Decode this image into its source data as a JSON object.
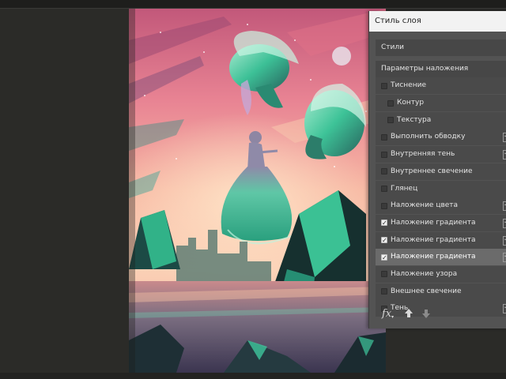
{
  "dialog": {
    "title": "Стиль слоя",
    "styles_label": "Стили",
    "blending_label": "Параметры наложения",
    "effects": [
      {
        "label": "Тиснение",
        "checked": false,
        "indent": false,
        "plus": false
      },
      {
        "label": "Контур",
        "checked": false,
        "indent": true,
        "plus": false
      },
      {
        "label": "Текстура",
        "checked": false,
        "indent": true,
        "plus": false
      },
      {
        "label": "Выполнить обводку",
        "checked": false,
        "indent": false,
        "plus": true
      },
      {
        "label": "Внутренняя тень",
        "checked": false,
        "indent": false,
        "plus": true
      },
      {
        "label": "Внутреннее свечение",
        "checked": false,
        "indent": false,
        "plus": false
      },
      {
        "label": "Глянец",
        "checked": false,
        "indent": false,
        "plus": false
      },
      {
        "label": "Наложение цвета",
        "checked": false,
        "indent": false,
        "plus": true
      },
      {
        "label": "Наложение градиента",
        "checked": true,
        "indent": false,
        "plus": true
      },
      {
        "label": "Наложение градиента",
        "checked": true,
        "indent": false,
        "plus": true
      },
      {
        "label": "Наложение градиента",
        "checked": true,
        "indent": false,
        "plus": true,
        "selected": true
      },
      {
        "label": "Наложение узора",
        "checked": false,
        "indent": false,
        "plus": false
      },
      {
        "label": "Внешнее свечение",
        "checked": false,
        "indent": false,
        "plus": false
      },
      {
        "label": "Тень",
        "checked": false,
        "indent": false,
        "plus": true
      }
    ],
    "footer": {
      "fx_label": "fx",
      "up_icon": "arrow-up-icon",
      "down_icon": "arrow-down-icon"
    }
  },
  "colors": {
    "workspace": "#2b2b28",
    "panel": "#535353",
    "row": "#4a4a4a",
    "row_selected": "#6b6b6b",
    "title_bar": "#f2f2f2",
    "art_sky_top": "#d86a7c",
    "art_sky_mid": "#f2a6a0",
    "art_teal": "#3cc79a"
  }
}
